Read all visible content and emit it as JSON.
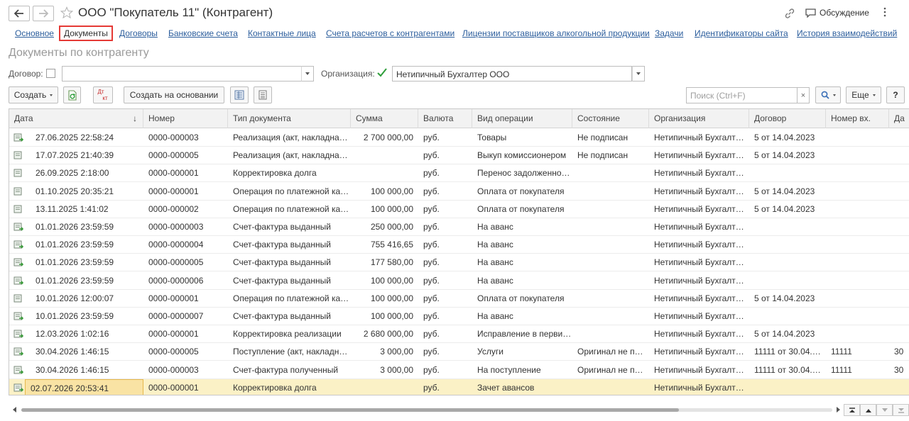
{
  "window": {
    "title": "ООО \"Покупатель 11\" (Контрагент)",
    "discussion_label": "Обсуждение"
  },
  "nav_links": [
    {
      "label": "Основное",
      "active": false
    },
    {
      "label": "Документы",
      "active": true
    },
    {
      "label": "Договоры",
      "active": false
    },
    {
      "label": "Банковские счета",
      "active": false
    },
    {
      "label": "Контактные лица",
      "active": false
    },
    {
      "label": "Счета расчетов с контрагентами",
      "active": false
    },
    {
      "label": "Лицензии поставщиков алкогольной продукции",
      "active": false
    },
    {
      "label": "Задачи",
      "active": false
    },
    {
      "label": "Идентификаторы сайта",
      "active": false
    },
    {
      "label": "История взаимодействий",
      "active": false
    }
  ],
  "page_subtitle": "Документы по контрагенту",
  "filters": {
    "contract_label": "Договор:",
    "contract_checked": false,
    "contract_value": "",
    "org_label": "Организация:",
    "org_checked": true,
    "org_value": "Нетипичный Бухгалтер ООО"
  },
  "toolbar": {
    "create_label": "Создать",
    "create_based_label": "Создать на основании",
    "dtkt_top": "Дт",
    "dtkt_bottom": "кт",
    "search_placeholder": "Поиск (Ctrl+F)",
    "search_clear": "×",
    "more_label": "Еще",
    "help_label": "?"
  },
  "table": {
    "columns": [
      "Дата",
      "Номер",
      "Тип документа",
      "Сумма",
      "Валюта",
      "Вид операции",
      "Состояние",
      "Организация",
      "Договор",
      "Номер вх.",
      "Да"
    ],
    "sort_indicator": "↓",
    "rows": [
      {
        "date": "27.06.2025 22:58:24",
        "number": "0000-000003",
        "type": "Реализация (акт, накладна…",
        "sum": "2 700 000,00",
        "currency": "руб.",
        "operation": "Товары",
        "state": "Не подписан",
        "org": "Нетипичный Бухгалт…",
        "contract": "5 от 14.04.2023",
        "in_number": "",
        "extra": "",
        "icon": "doc-arrow",
        "selected": false
      },
      {
        "date": "17.07.2025 21:40:39",
        "number": "0000-000005",
        "type": "Реализация (акт, накладна…",
        "sum": "",
        "currency": "руб.",
        "operation": "Выкуп комиссионером",
        "state": "Не подписан",
        "org": "Нетипичный Бухгалт…",
        "contract": "5 от 14.04.2023",
        "in_number": "",
        "extra": "",
        "icon": "doc",
        "selected": false
      },
      {
        "date": "26.09.2025 2:18:00",
        "number": "0000-000001",
        "type": "Корректировка долга",
        "sum": "",
        "currency": "руб.",
        "operation": "Перенос задолженно…",
        "state": "",
        "org": "Нетипичный Бухгалт…",
        "contract": "",
        "in_number": "",
        "extra": "",
        "icon": "doc",
        "selected": false
      },
      {
        "date": "01.10.2025 20:35:21",
        "number": "0000-000001",
        "type": "Операция по платежной ка…",
        "sum": "100 000,00",
        "currency": "руб.",
        "operation": "Оплата от покупателя",
        "state": "",
        "org": "Нетипичный Бухгалт…",
        "contract": "5 от 14.04.2023",
        "in_number": "",
        "extra": "",
        "icon": "doc",
        "selected": false
      },
      {
        "date": "13.11.2025 1:41:02",
        "number": "0000-000002",
        "type": "Операция по платежной ка…",
        "sum": "100 000,00",
        "currency": "руб.",
        "operation": "Оплата от покупателя",
        "state": "",
        "org": "Нетипичный Бухгалт…",
        "contract": "5 от 14.04.2023",
        "in_number": "",
        "extra": "",
        "icon": "doc",
        "selected": false
      },
      {
        "date": "01.01.2026 23:59:59",
        "number": "0000-0000003",
        "type": "Счет-фактура выданный",
        "sum": "250 000,00",
        "currency": "руб.",
        "operation": "На аванс",
        "state": "",
        "org": "Нетипичный Бухгалт…",
        "contract": "",
        "in_number": "",
        "extra": "",
        "icon": "doc-arrow",
        "selected": false
      },
      {
        "date": "01.01.2026 23:59:59",
        "number": "0000-0000004",
        "type": "Счет-фактура выданный",
        "sum": "755 416,65",
        "currency": "руб.",
        "operation": "На аванс",
        "state": "",
        "org": "Нетипичный Бухгалт…",
        "contract": "",
        "in_number": "",
        "extra": "",
        "icon": "doc-arrow",
        "selected": false
      },
      {
        "date": "01.01.2026 23:59:59",
        "number": "0000-0000005",
        "type": "Счет-фактура выданный",
        "sum": "177 580,00",
        "currency": "руб.",
        "operation": "На аванс",
        "state": "",
        "org": "Нетипичный Бухгалт…",
        "contract": "",
        "in_number": "",
        "extra": "",
        "icon": "doc-arrow",
        "selected": false
      },
      {
        "date": "01.01.2026 23:59:59",
        "number": "0000-0000006",
        "type": "Счет-фактура выданный",
        "sum": "100 000,00",
        "currency": "руб.",
        "operation": "На аванс",
        "state": "",
        "org": "Нетипичный Бухгалт…",
        "contract": "",
        "in_number": "",
        "extra": "",
        "icon": "doc-arrow",
        "selected": false
      },
      {
        "date": "10.01.2026 12:00:07",
        "number": "0000-000001",
        "type": "Операция по платежной ка…",
        "sum": "100 000,00",
        "currency": "руб.",
        "operation": "Оплата от покупателя",
        "state": "",
        "org": "Нетипичный Бухгалт…",
        "contract": "5 от 14.04.2023",
        "in_number": "",
        "extra": "",
        "icon": "doc",
        "selected": false
      },
      {
        "date": "10.01.2026 23:59:59",
        "number": "0000-0000007",
        "type": "Счет-фактура выданный",
        "sum": "100 000,00",
        "currency": "руб.",
        "operation": "На аванс",
        "state": "",
        "org": "Нетипичный Бухгалт…",
        "contract": "",
        "in_number": "",
        "extra": "",
        "icon": "doc-arrow",
        "selected": false
      },
      {
        "date": "12.03.2026 1:02:16",
        "number": "0000-000001",
        "type": "Корректировка реализации",
        "sum": "2 680 000,00",
        "currency": "руб.",
        "operation": "Исправление в перви…",
        "state": "",
        "org": "Нетипичный Бухгалт…",
        "contract": "5 от 14.04.2023",
        "in_number": "",
        "extra": "",
        "icon": "doc-arrow",
        "selected": false
      },
      {
        "date": "30.04.2026 1:46:15",
        "number": "0000-000005",
        "type": "Поступление (акт, накладн…",
        "sum": "3 000,00",
        "currency": "руб.",
        "operation": "Услуги",
        "state": "Оригинал не п…",
        "org": "Нетипичный Бухгалт…",
        "contract": "11111 от 30.04.…",
        "in_number": "11111",
        "extra": "30",
        "icon": "doc-arrow",
        "selected": false
      },
      {
        "date": "30.04.2026 1:46:15",
        "number": "0000-000003",
        "type": "Счет-фактура полученный",
        "sum": "3 000,00",
        "currency": "руб.",
        "operation": "На поступление",
        "state": "Оригинал не п…",
        "org": "Нетипичный Бухгалт…",
        "contract": "11111 от 30.04.…",
        "in_number": "11111",
        "extra": "30",
        "icon": "doc-arrow",
        "selected": false
      },
      {
        "date": "02.07.2026 20:53:41",
        "number": "0000-000001",
        "type": "Корректировка долга",
        "sum": "",
        "currency": "руб.",
        "operation": "Зачет авансов",
        "state": "",
        "org": "Нетипичный Бухгалт…",
        "contract": "",
        "in_number": "",
        "extra": "",
        "icon": "doc-arrow",
        "selected": true
      }
    ]
  },
  "colors": {
    "link": "#2b5d9c",
    "active_tab_border": "#e53935",
    "selected_row": "#fbf1c6",
    "doc_icon_green": "#3a9a3a"
  }
}
